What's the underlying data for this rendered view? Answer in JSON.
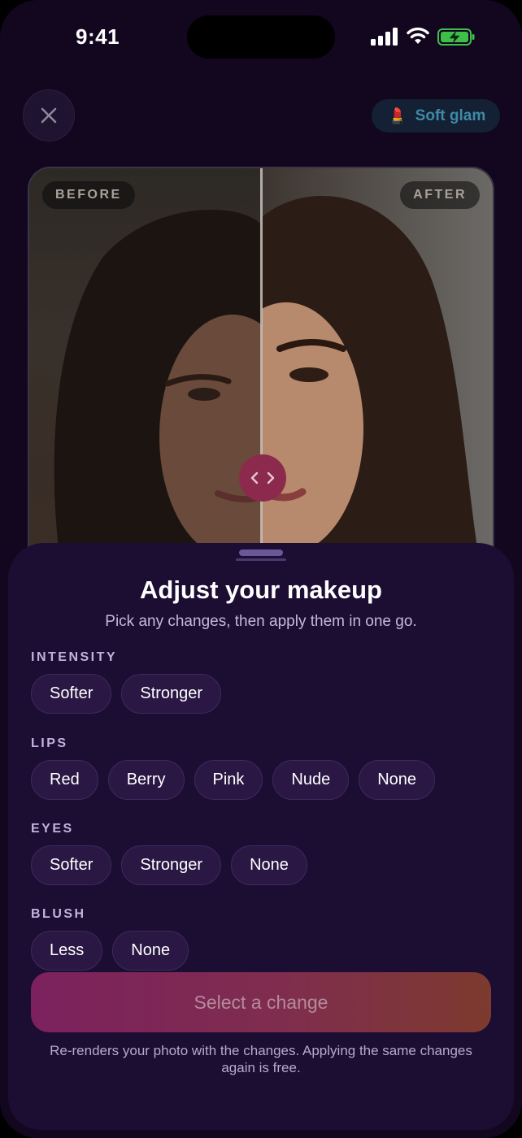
{
  "status_bar": {
    "time": "9:41"
  },
  "header": {
    "close_icon": "close-icon",
    "style_chip": {
      "emoji": "💄",
      "label": "Soft glam",
      "color": "#3f8aa6"
    }
  },
  "compare": {
    "before_label": "BEFORE",
    "after_label": "AFTER",
    "handle_icon": "chevron-left-right-icon"
  },
  "sheet": {
    "title": "Adjust your makeup",
    "subtitle": "Pick any changes, then apply them in one go.",
    "sections": [
      {
        "label": "INTENSITY",
        "options": [
          "Softer",
          "Stronger"
        ]
      },
      {
        "label": "LIPS",
        "options": [
          "Red",
          "Berry",
          "Pink",
          "Nude",
          "None"
        ]
      },
      {
        "label": "EYES",
        "options": [
          "Softer",
          "Stronger",
          "None"
        ]
      },
      {
        "label": "BLUSH",
        "options": [
          "Less",
          "None"
        ]
      }
    ],
    "apply_button": "Select a change",
    "footnote": "Re-renders your photo with the changes. Applying the same changes again is free."
  },
  "colors": {
    "background": "#12071f",
    "sheet": "#1c0d33",
    "chip": "#2a1744",
    "accent_gradient_start": "#7c215e",
    "accent_gradient_end": "#7d3a2e"
  }
}
